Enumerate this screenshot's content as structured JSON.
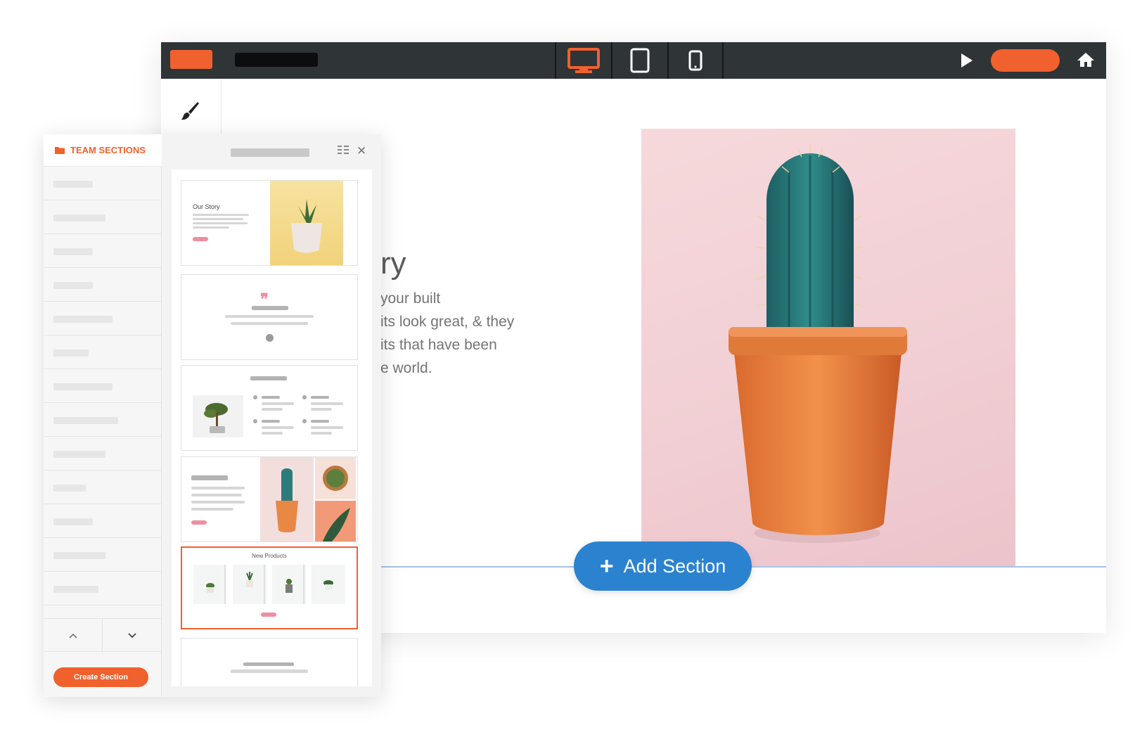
{
  "colors": {
    "accent": "#f0612d",
    "topbar": "#2f3437",
    "add_section": "#2b83cf"
  },
  "topbar": {
    "devices": [
      {
        "name": "desktop-icon",
        "active": true
      },
      {
        "name": "tablet-icon",
        "active": false
      },
      {
        "name": "phone-icon",
        "active": false
      }
    ],
    "icons": [
      "play-icon",
      "home-icon"
    ]
  },
  "toolstrip": {
    "icon": "paintbrush-icon"
  },
  "canvas": {
    "heading_fragment": "ry",
    "body_lines": [
      "your built",
      "its look great, & they",
      "its that have been",
      "e world."
    ],
    "add_section_label": "Add Section"
  },
  "panel": {
    "header": "TEAM SECTIONS",
    "create_button": "Create Section",
    "arrows": [
      "chevron-up-icon",
      "chevron-down-icon"
    ]
  },
  "cards": [
    {
      "kind": "story",
      "title": "Our Story"
    },
    {
      "kind": "quote"
    },
    {
      "kind": "feature-list"
    },
    {
      "kind": "product-grid"
    },
    {
      "kind": "new-products",
      "title": "New Products",
      "selected": true
    },
    {
      "kind": "partial"
    }
  ]
}
